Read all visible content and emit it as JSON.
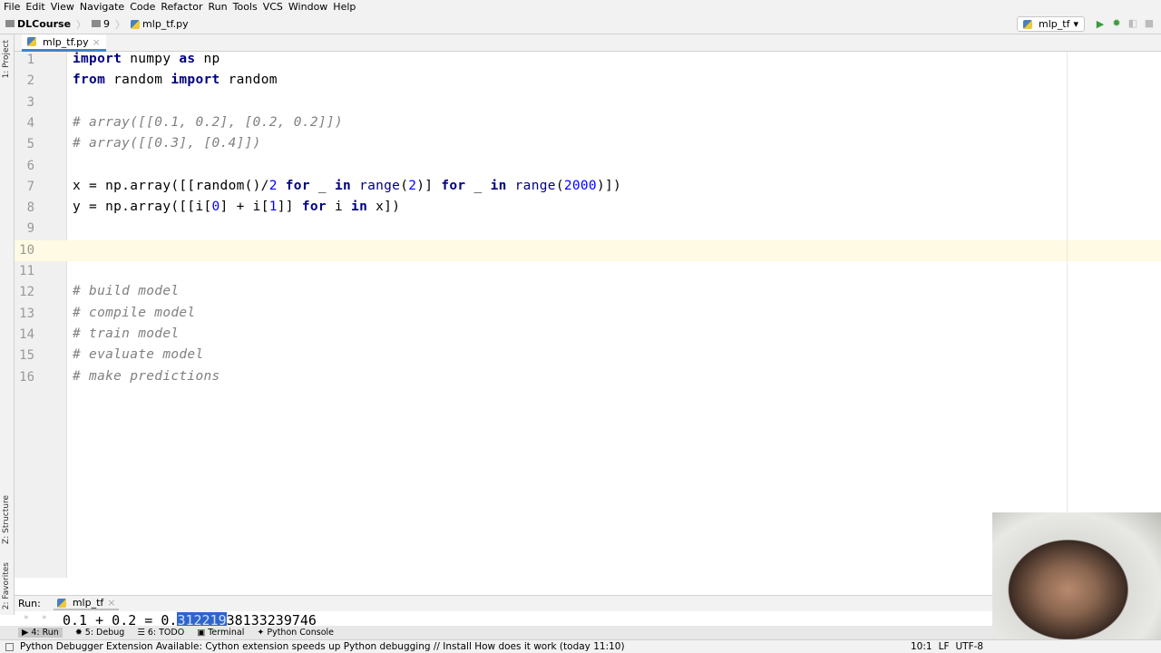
{
  "menu": [
    "File",
    "Edit",
    "View",
    "Navigate",
    "Code",
    "Refactor",
    "Run",
    "Tools",
    "VCS",
    "Window",
    "Help"
  ],
  "breadcrumb": [
    "DLCourse",
    "9",
    "mlp_tf.py"
  ],
  "run_config": "mlp_tf",
  "tab": "mlp_tf.py",
  "side_labels": {
    "project": "1: Project",
    "structure": "Z: Structure",
    "favorites": "2: Favorites"
  },
  "code": [
    [
      [
        "import",
        "kw"
      ],
      [
        " numpy ",
        "pl"
      ],
      [
        "as",
        "kw"
      ],
      [
        " np",
        "pl"
      ]
    ],
    [
      [
        "from",
        "kw"
      ],
      [
        " random ",
        "pl"
      ],
      [
        "import",
        "kw"
      ],
      [
        " random",
        "pl"
      ]
    ],
    [],
    [
      [
        "# array([[0.1, 0.2], [0.2, 0.2]])",
        "cm"
      ]
    ],
    [
      [
        "# array([[0.3], [0.4]])",
        "cm"
      ]
    ],
    [],
    [
      [
        "x = np.array([[random()/",
        "pl"
      ],
      [
        "2",
        "num"
      ],
      [
        " ",
        "pl"
      ],
      [
        "for",
        "kw"
      ],
      [
        " _ ",
        "pl"
      ],
      [
        "in",
        "kw"
      ],
      [
        " ",
        "pl"
      ],
      [
        "range",
        "bi"
      ],
      [
        "(",
        "pl"
      ],
      [
        "2",
        "num"
      ],
      [
        ")] ",
        "pl"
      ],
      [
        "for",
        "kw"
      ],
      [
        " _ ",
        "pl"
      ],
      [
        "in",
        "kw"
      ],
      [
        " ",
        "pl"
      ],
      [
        "range",
        "bi"
      ],
      [
        "(",
        "pl"
      ],
      [
        "2000",
        "num"
      ],
      [
        ")])",
        "pl"
      ]
    ],
    [
      [
        "y = np.array([[i[",
        "pl"
      ],
      [
        "0",
        "num"
      ],
      [
        "] + i[",
        "pl"
      ],
      [
        "1",
        "num"
      ],
      [
        "]] ",
        "pl"
      ],
      [
        "for",
        "kw"
      ],
      [
        " i ",
        "pl"
      ],
      [
        "in",
        "kw"
      ],
      [
        " x])",
        "pl"
      ]
    ],
    [],
    [],
    [],
    [
      [
        "# build model",
        "cm"
      ]
    ],
    [
      [
        "# compile model",
        "cm"
      ]
    ],
    [
      [
        "# train model",
        "cm"
      ]
    ],
    [
      [
        "# evaluate model",
        "cm"
      ]
    ],
    [
      [
        "# make predictions",
        "cm"
      ]
    ]
  ],
  "run": {
    "label": "Run:",
    "tab": "mlp_tf"
  },
  "output": {
    "before": "0.1 + 0.2 = 0.",
    "selected": "312219",
    "after": "38133239746"
  },
  "toolwindows": [
    "4: Run",
    "5: Debug",
    "6: TODO",
    "Terminal",
    "Python Console"
  ],
  "status": {
    "message": "Python Debugger Extension Available: Cython extension speeds up Python debugging // Install  How does it work (today 11:10)",
    "position": "10:1",
    "line_sep": "LF",
    "encoding": "UTF-8"
  }
}
